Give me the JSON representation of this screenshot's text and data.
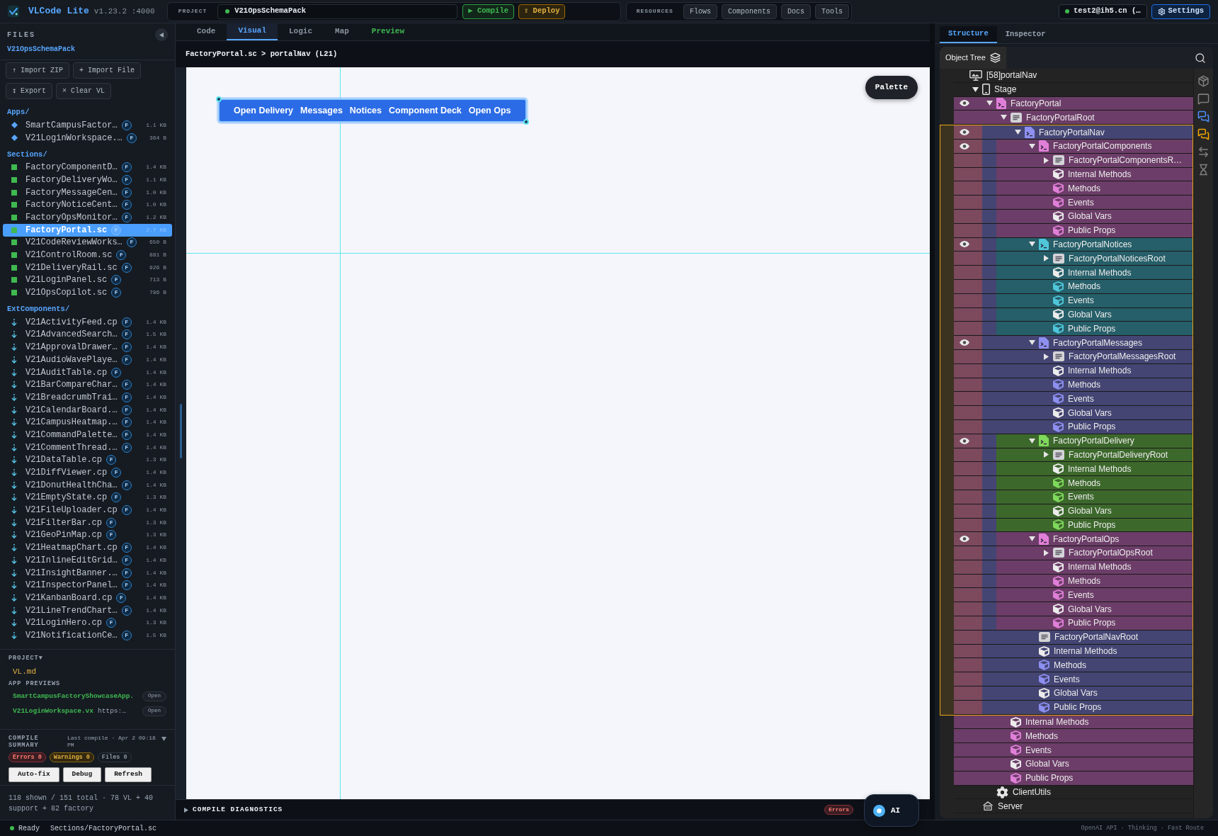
{
  "top_bar": {
    "app_name": "VLCode Lite",
    "version": "v1.23.2 :4000",
    "project_label": "PROJECT",
    "project_name": "V21OpsSchemaPack",
    "compile_button": "▶ Compile",
    "deploy_button": "⇧ Deploy",
    "resources_label": "RESOURCES",
    "resource_links": [
      "Flows",
      "Components",
      "Docs",
      "Tools"
    ],
    "user": "test2@ih5.cn (…",
    "settings_button": "Settings"
  },
  "sidebar": {
    "title": "FILES",
    "project": "V21OpsSchemaPack",
    "actions": [
      "⇡ Import ZIP",
      "+ Import File",
      "↧ Export",
      "× Clear VL"
    ],
    "groups": [
      {
        "name": "Apps/",
        "kind": "app",
        "files": [
          {
            "name": "SmartCampusFactor…",
            "badge": "F",
            "size": "1.1 KB",
            "selected": false
          },
          {
            "name": "V21LoginWorkspace.…",
            "badge": "F",
            "size": "364 B",
            "selected": false
          }
        ]
      },
      {
        "name": "Sections/",
        "kind": "section",
        "files": [
          {
            "name": "FactoryComponentD…",
            "badge": "F",
            "size": "1.4 KB",
            "selected": false
          },
          {
            "name": "FactoryDeliveryWo…",
            "badge": "F",
            "size": "1.1 KB",
            "selected": false
          },
          {
            "name": "FactoryMessageCen…",
            "badge": "F",
            "size": "1.0 KB",
            "selected": false
          },
          {
            "name": "FactoryNoticeCent…",
            "badge": "F",
            "size": "1.0 KB",
            "selected": false
          },
          {
            "name": "FactoryOpsMonitor…",
            "badge": "F",
            "size": "1.2 KB",
            "selected": false
          },
          {
            "name": "FactoryPortal.sc",
            "badge": "F",
            "size": "2.7 KB",
            "selected": true
          },
          {
            "name": "V21CodeReviewWorks…",
            "badge": "F",
            "size": "650 B",
            "selected": false
          },
          {
            "name": "V21ControlRoom.sc",
            "badge": "F",
            "size": "881 B",
            "selected": false
          },
          {
            "name": "V21DeliveryRail.sc",
            "badge": "F",
            "size": "926 B",
            "selected": false
          },
          {
            "name": "V21LoginPanel.sc",
            "badge": "F",
            "size": "713 B",
            "selected": false
          },
          {
            "name": "V21OpsCopilot.sc",
            "badge": "F",
            "size": "786 B",
            "selected": false
          }
        ]
      },
      {
        "name": "ExtComponents/",
        "kind": "ext",
        "files": [
          {
            "name": "V21ActivityFeed.cp",
            "badge": "F",
            "size": "1.4 KB",
            "selected": false
          },
          {
            "name": "V21AdvancedSearch…",
            "badge": "F",
            "size": "1.5 KB",
            "selected": false
          },
          {
            "name": "V21ApprovalDrawer…",
            "badge": "F",
            "size": "1.4 KB",
            "selected": false
          },
          {
            "name": "V21AudioWavePlaye…",
            "badge": "F",
            "size": "1.4 KB",
            "selected": false
          },
          {
            "name": "V21AuditTable.cp",
            "badge": "F",
            "size": "1.4 KB",
            "selected": false
          },
          {
            "name": "V21BarCompareChar…",
            "badge": "F",
            "size": "1.4 KB",
            "selected": false
          },
          {
            "name": "V21BreadcrumbTrai…",
            "badge": "F",
            "size": "1.4 KB",
            "selected": false
          },
          {
            "name": "V21CalendarBoard.…",
            "badge": "F",
            "size": "1.4 KB",
            "selected": false
          },
          {
            "name": "V21CampusHeatmap.…",
            "badge": "F",
            "size": "1.4 KB",
            "selected": false
          },
          {
            "name": "V21CommandPalette…",
            "badge": "F",
            "size": "1.4 KB",
            "selected": false
          },
          {
            "name": "V21CommentThread.…",
            "badge": "F",
            "size": "1.4 KB",
            "selected": false
          },
          {
            "name": "V21DataTable.cp",
            "badge": "F",
            "size": "1.3 KB",
            "selected": false
          },
          {
            "name": "V21DiffViewer.cp",
            "badge": "F",
            "size": "1.4 KB",
            "selected": false
          },
          {
            "name": "V21DonutHealthCha…",
            "badge": "F",
            "size": "1.4 KB",
            "selected": false
          },
          {
            "name": "V21EmptyState.cp",
            "badge": "F",
            "size": "1.3 KB",
            "selected": false
          },
          {
            "name": "V21FileUploader.cp",
            "badge": "F",
            "size": "1.4 KB",
            "selected": false
          },
          {
            "name": "V21FilterBar.cp",
            "badge": "F",
            "size": "1.3 KB",
            "selected": false
          },
          {
            "name": "V21GeoPinMap.cp",
            "badge": "F",
            "size": "1.3 KB",
            "selected": false
          },
          {
            "name": "V21HeatmapChart.cp",
            "badge": "F",
            "size": "1.4 KB",
            "selected": false
          },
          {
            "name": "V21InlineEditGrid…",
            "badge": "F",
            "size": "1.4 KB",
            "selected": false
          },
          {
            "name": "V21InsightBanner.…",
            "badge": "F",
            "size": "1.4 KB",
            "selected": false
          },
          {
            "name": "V21InspectorPanel…",
            "badge": "F",
            "size": "1.4 KB",
            "selected": false
          },
          {
            "name": "V21KanbanBoard.cp",
            "badge": "F",
            "size": "1.4 KB",
            "selected": false
          },
          {
            "name": "V21LineTrendChart…",
            "badge": "F",
            "size": "1.4 KB",
            "selected": false
          },
          {
            "name": "V21LoginHero.cp",
            "badge": "F",
            "size": "1.3 KB",
            "selected": false
          },
          {
            "name": "V21NotificationCe…",
            "badge": "F",
            "size": "1.5 KB",
            "selected": false
          }
        ]
      }
    ],
    "project_section": {
      "title": "PROJECT▼",
      "files": [
        "VL.md"
      ]
    },
    "app_previews": {
      "title": "APP PREVIEWS",
      "items": [
        {
          "name": "SmartCampusFactoryShowcaseApp.",
          "action": "Open"
        },
        {
          "name": "V21LoginWorkspace.vx",
          "url": "https:…",
          "action": "Open"
        }
      ]
    },
    "compile_summary": {
      "title": "COMPILE SUMMARY",
      "last_compile": "Last compile · Apr 2 09:18 PM",
      "badges": [
        {
          "label": "Errors 0",
          "kind": "error"
        },
        {
          "label": "Warnings 0",
          "kind": "warning"
        },
        {
          "label": "Files 0",
          "kind": "neutral"
        }
      ],
      "buttons": [
        "Auto-fix",
        "Debug",
        "Refresh"
      ]
    },
    "summary": "118 shown / 151 total · 78 VL + 40 support + 82 factory"
  },
  "editor": {
    "tabs": [
      {
        "label": "Code",
        "kind": "view",
        "selected": false
      },
      {
        "label": "Visual",
        "kind": "view",
        "selected": true
      },
      {
        "label": "Logic",
        "kind": "view",
        "selected": false
      },
      {
        "label": "Map",
        "kind": "view",
        "selected": false
      },
      {
        "label": "Preview",
        "kind": "action",
        "selected": false
      }
    ],
    "breadcrumb": "FactoryPortal.sc > portalNav (L21)",
    "canvas": {
      "palette_button": "Palette",
      "nav_items": [
        "Open Delivery",
        "Messages",
        "Notices",
        "Component Deck",
        "Open Ops"
      ]
    },
    "diagnostics": {
      "title": "COMPILE DIAGNOSTICS",
      "expanded": false,
      "badge": "Errors"
    },
    "ai_button": "AI"
  },
  "inspector_panel": {
    "tabs": [
      {
        "label": "Structure",
        "selected": true
      },
      {
        "label": "Inspector",
        "selected": false
      }
    ],
    "tree": {
      "title": "Object Tree",
      "header_item": "[58]portalNav",
      "items": [
        {
          "kind": "device",
          "label": "Stage",
          "expanded": true,
          "selected": false,
          "children": [
            {
              "kind": "component",
              "label": "FactoryPortal",
              "color": "#e07fd8",
              "visible": true,
              "expanded": true,
              "selected": false,
              "children": [
                {
                  "kind": "root",
                  "label": "FactoryPortalRoot",
                  "expanded": true,
                  "selected": false,
                  "children": [
                    {
                      "kind": "component",
                      "label": "FactoryPortalNav",
                      "color": "#8d90f0",
                      "visible": true,
                      "expanded": true,
                      "selected": true,
                      "children": [
                        {
                          "kind": "component",
                          "label": "FactoryPortalComponents",
                          "color": "#e07fd8",
                          "visible": true,
                          "expanded": true,
                          "selected": false,
                          "children": [
                            {
                              "kind": "root",
                              "label": "FactoryPortalComponentsR…",
                              "expanded": false,
                              "selected": false
                            },
                            {
                              "kind": "member",
                              "label": "Internal Methods",
                              "tinted": false,
                              "selected": false
                            },
                            {
                              "kind": "member",
                              "label": "Methods",
                              "tinted": true,
                              "selected": false
                            },
                            {
                              "kind": "member",
                              "label": "Events",
                              "tinted": true,
                              "selected": false
                            },
                            {
                              "kind": "member",
                              "label": "Global Vars",
                              "tinted": false,
                              "selected": false
                            },
                            {
                              "kind": "member",
                              "label": "Public Props",
                              "tinted": true,
                              "selected": false
                            }
                          ]
                        },
                        {
                          "kind": "component",
                          "label": "FactoryPortalNotices",
                          "color": "#4fc6da",
                          "visible": true,
                          "expanded": true,
                          "selected": false,
                          "children": [
                            {
                              "kind": "root",
                              "label": "FactoryPortalNoticesRoot",
                              "expanded": false,
                              "selected": false
                            },
                            {
                              "kind": "member",
                              "label": "Internal Methods",
                              "tinted": false,
                              "selected": false
                            },
                            {
                              "kind": "member",
                              "label": "Methods",
                              "tinted": true,
                              "selected": false
                            },
                            {
                              "kind": "member",
                              "label": "Events",
                              "tinted": true,
                              "selected": false
                            },
                            {
                              "kind": "member",
                              "label": "Global Vars",
                              "tinted": false,
                              "selected": false
                            },
                            {
                              "kind": "member",
                              "label": "Public Props",
                              "tinted": true,
                              "selected": false
                            }
                          ]
                        },
                        {
                          "kind": "component",
                          "label": "FactoryPortalMessages",
                          "color": "#8d90f0",
                          "visible": true,
                          "expanded": true,
                          "selected": false,
                          "children": [
                            {
                              "kind": "root",
                              "label": "FactoryPortalMessagesRoot",
                              "expanded": false,
                              "selected": false
                            },
                            {
                              "kind": "member",
                              "label": "Internal Methods",
                              "tinted": false,
                              "selected": false
                            },
                            {
                              "kind": "member",
                              "label": "Methods",
                              "tinted": true,
                              "selected": false
                            },
                            {
                              "kind": "member",
                              "label": "Events",
                              "tinted": true,
                              "selected": false
                            },
                            {
                              "kind": "member",
                              "label": "Global Vars",
                              "tinted": false,
                              "selected": false
                            },
                            {
                              "kind": "member",
                              "label": "Public Props",
                              "tinted": true,
                              "selected": false
                            }
                          ]
                        },
                        {
                          "kind": "component",
                          "label": "FactoryPortalDelivery",
                          "color": "#7fd95c",
                          "visible": true,
                          "expanded": true,
                          "selected": false,
                          "children": [
                            {
                              "kind": "root",
                              "label": "FactoryPortalDeliveryRoot",
                              "expanded": false,
                              "selected": false
                            },
                            {
                              "kind": "member",
                              "label": "Internal Methods",
                              "tinted": false,
                              "selected": false
                            },
                            {
                              "kind": "member",
                              "label": "Methods",
                              "tinted": true,
                              "selected": false
                            },
                            {
                              "kind": "member",
                              "label": "Events",
                              "tinted": true,
                              "selected": false
                            },
                            {
                              "kind": "member",
                              "label": "Global Vars",
                              "tinted": false,
                              "selected": false
                            },
                            {
                              "kind": "member",
                              "label": "Public Props",
                              "tinted": true,
                              "selected": false
                            }
                          ]
                        },
                        {
                          "kind": "component",
                          "label": "FactoryPortalOps",
                          "color": "#e07fd8",
                          "visible": true,
                          "expanded": true,
                          "selected": false,
                          "children": [
                            {
                              "kind": "root",
                              "label": "FactoryPortalOpsRoot",
                              "expanded": false,
                              "selected": false
                            },
                            {
                              "kind": "member",
                              "label": "Internal Methods",
                              "tinted": false,
                              "selected": false
                            },
                            {
                              "kind": "member",
                              "label": "Methods",
                              "tinted": true,
                              "selected": false
                            },
                            {
                              "kind": "member",
                              "label": "Events",
                              "tinted": true,
                              "selected": false
                            },
                            {
                              "kind": "member",
                              "label": "Global Vars",
                              "tinted": false,
                              "selected": false
                            },
                            {
                              "kind": "member",
                              "label": "Public Props",
                              "tinted": true,
                              "selected": false
                            }
                          ]
                        },
                        {
                          "kind": "root",
                          "label": "FactoryPortalNavRoot",
                          "selected": false
                        },
                        {
                          "kind": "member",
                          "label": "Internal Methods",
                          "tinted": false,
                          "selected": false
                        },
                        {
                          "kind": "member",
                          "label": "Methods",
                          "tinted": true,
                          "selected": false
                        },
                        {
                          "kind": "member",
                          "label": "Events",
                          "tinted": true,
                          "selected": false
                        },
                        {
                          "kind": "member",
                          "label": "Global Vars",
                          "tinted": false,
                          "selected": false
                        },
                        {
                          "kind": "member",
                          "label": "Public Props",
                          "tinted": true,
                          "selected": false
                        }
                      ]
                    }
                  ]
                },
                {
                  "kind": "member",
                  "label": "Internal Methods",
                  "tinted": false,
                  "selected": false
                },
                {
                  "kind": "member",
                  "label": "Methods",
                  "tinted": true,
                  "selected": false
                },
                {
                  "kind": "member",
                  "label": "Events",
                  "tinted": true,
                  "selected": false
                },
                {
                  "kind": "member",
                  "label": "Global Vars",
                  "tinted": false,
                  "selected": false
                },
                {
                  "kind": "member",
                  "label": "Public Props",
                  "tinted": true,
                  "selected": false
                }
              ]
            },
            {
              "kind": "gear",
              "label": "ClientUtils",
              "selected": false
            }
          ]
        },
        {
          "kind": "server",
          "label": "Server",
          "selected": false
        }
      ]
    },
    "side_tools": [
      {
        "kind": "box"
      },
      {
        "kind": "bubble"
      },
      {
        "kind": "bubbles",
        "color": "#4c8df6"
      },
      {
        "kind": "bubbles",
        "color": "#f0a500"
      },
      {
        "kind": "swap"
      },
      {
        "kind": "hourglass"
      }
    ]
  },
  "status_bar": {
    "state": "Ready",
    "path": "Sections/FactoryPortal.sc",
    "info": "OpenAI API · Thinking · Fast Route"
  }
}
